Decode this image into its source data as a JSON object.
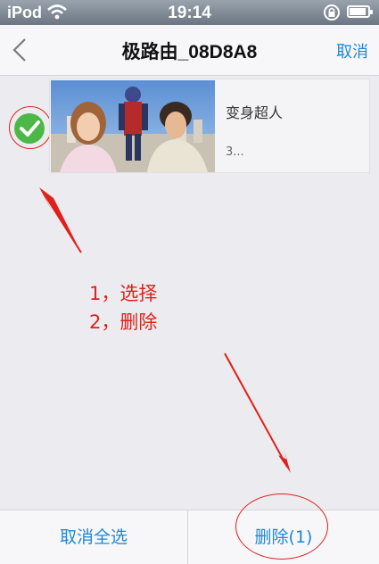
{
  "status_bar": {
    "carrier": "iPod",
    "time": "19:14"
  },
  "nav": {
    "title": "极路由_08D8A8",
    "cancel_label": "取消"
  },
  "video": {
    "title": "变身超人",
    "meta": "3..."
  },
  "annotations": {
    "step1": "1，选择",
    "step2": "2，删除"
  },
  "bottom": {
    "select_all_label": "取消全选",
    "delete_label": "删除(1)"
  },
  "colors": {
    "accent": "#1e88d8",
    "annotation": "#e0201a",
    "check": "#4cb848"
  }
}
